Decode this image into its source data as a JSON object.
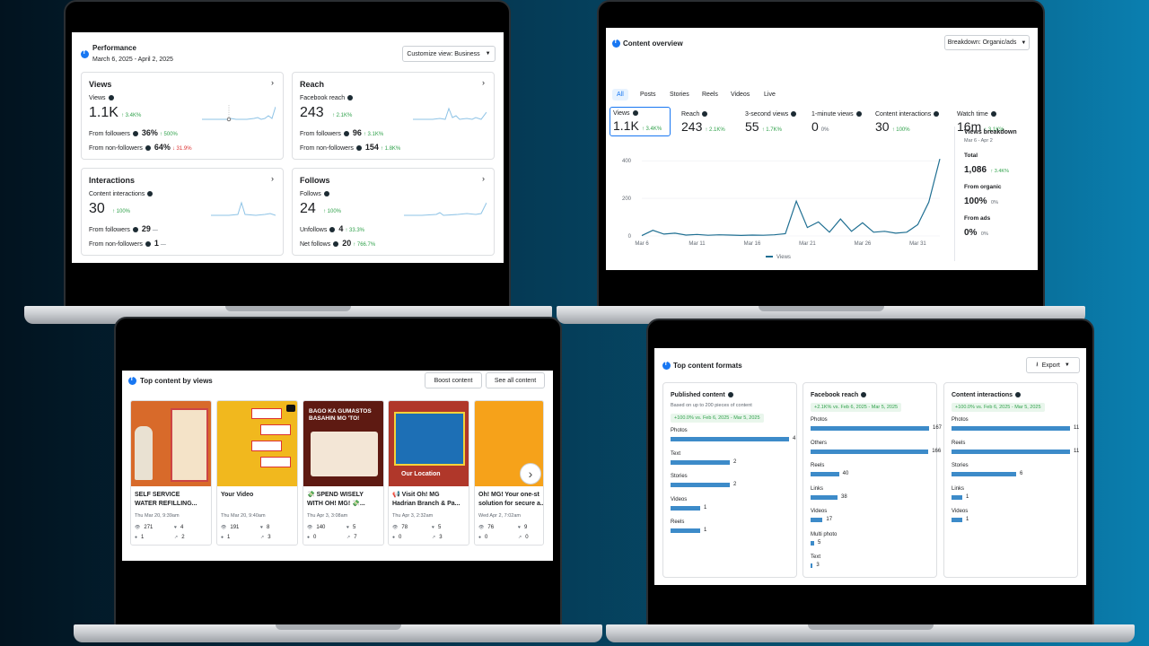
{
  "performance": {
    "title": "Performance",
    "date_range": "March 6, 2025 - April 2, 2025",
    "customize": "Customize view: Business",
    "views": {
      "title": "Views",
      "sub": "Views",
      "value": "1.1K",
      "delta": "↑ 3.4K%",
      "r1_label": "From followers",
      "r1_value": "36%",
      "r1_delta": "↑ 500%",
      "r2_label": "From non-followers",
      "r2_value": "64%",
      "r2_delta": "↓ 31.9%"
    },
    "reach": {
      "title": "Reach",
      "sub": "Facebook reach",
      "value": "243",
      "delta": "↑ 2.1K%",
      "r1_label": "From followers",
      "r1_value": "96",
      "r1_delta": "↑ 3.1K%",
      "r2_label": "From non-followers",
      "r2_value": "154",
      "r2_delta": "↑ 1.8K%"
    },
    "interactions": {
      "title": "Interactions",
      "sub": "Content interactions",
      "value": "30",
      "delta": "↑ 100%",
      "r1_label": "From followers",
      "r1_value": "29",
      "r1_delta": "—",
      "r2_label": "From non-followers",
      "r2_value": "1",
      "r2_delta": "—"
    },
    "follows": {
      "title": "Follows",
      "sub": "Follows",
      "value": "24",
      "delta": "↑ 100%",
      "r1_label": "Unfollows",
      "r1_value": "4",
      "r1_delta": "↑ 33.3%",
      "r2_label": "Net follows",
      "r2_value": "20",
      "r2_delta": "↑ 766.7%"
    }
  },
  "overview": {
    "title": "Content overview",
    "breakdown": "Breakdown: Organic/ads",
    "tabs": [
      "All",
      "Posts",
      "Stories",
      "Reels",
      "Videos",
      "Live"
    ],
    "metrics": [
      {
        "label": "Views",
        "value": "1.1K",
        "delta": "↑ 3.4K%"
      },
      {
        "label": "Reach",
        "value": "243",
        "delta": "↑ 2.1K%"
      },
      {
        "label": "3-second views",
        "value": "55",
        "delta": "↑ 1.7K%"
      },
      {
        "label": "1-minute views",
        "value": "0",
        "delta": "0%"
      },
      {
        "label": "Content interactions",
        "value": "30",
        "delta": "↑ 100%"
      },
      {
        "label": "Watch time",
        "value": "16m",
        "delta": "↑ 3.1K%"
      }
    ],
    "breakdown_panel": {
      "title": "Views breakdown",
      "range": "Mar 6 - Apr 2",
      "total_label": "Total",
      "total_value": "1,086",
      "total_delta": "↑ 3.4K%",
      "organic_label": "From organic",
      "organic_value": "100%",
      "organic_delta": "0%",
      "ads_label": "From ads",
      "ads_value": "0%",
      "ads_delta": "0%"
    }
  },
  "chart_data": {
    "type": "line",
    "x": [
      "Mar 6",
      "Mar 7",
      "Mar 8",
      "Mar 9",
      "Mar 10",
      "Mar 11",
      "Mar 12",
      "Mar 13",
      "Mar 14",
      "Mar 15",
      "Mar 16",
      "Mar 17",
      "Mar 18",
      "Mar 19",
      "Mar 20",
      "Mar 21",
      "Mar 22",
      "Mar 23",
      "Mar 24",
      "Mar 25",
      "Mar 26",
      "Mar 27",
      "Mar 28",
      "Mar 29",
      "Mar 30",
      "Mar 31",
      "Apr 1",
      "Apr 2"
    ],
    "series": [
      {
        "name": "Views",
        "values": [
          2,
          30,
          10,
          15,
          5,
          8,
          4,
          6,
          5,
          3,
          5,
          4,
          6,
          12,
          185,
          45,
          75,
          20,
          90,
          25,
          70,
          20,
          25,
          15,
          20,
          60,
          180,
          410
        ]
      }
    ],
    "xticks": [
      "Mar 6",
      "Mar 11",
      "Mar 16",
      "Mar 21",
      "Mar 26",
      "Mar 31"
    ],
    "yticks": [
      "0",
      "200",
      "400"
    ],
    "ylim": [
      0,
      420
    ],
    "legend": "bottom"
  },
  "top_content": {
    "title": "Top content by views",
    "boost": "Boost content",
    "see_all": "See all content",
    "posts": [
      {
        "title": "SELF SERVICE\nWATER REFILLING...",
        "date": "Thu Mar 20, 9:39am",
        "views": "271",
        "likes": "4",
        "comments": "1",
        "shares": "2",
        "color": "#d86a2a"
      },
      {
        "title": "Your Video",
        "date": "Thu Mar 20, 9:40am",
        "views": "191",
        "likes": "8",
        "comments": "1",
        "shares": "3",
        "color": "#f1b81e"
      },
      {
        "title": "💸 SPEND WISELY\nWITH OH! MG! 💸...",
        "date": "Thu Apr 3, 3:08am",
        "views": "140",
        "likes": "5",
        "comments": "0",
        "shares": "7",
        "color": "#5e1a12"
      },
      {
        "title": "📢 Visit Oh! MG\nHadrian Branch & Pa...",
        "date": "Thu Apr 3, 2:32am",
        "views": "78",
        "likes": "5",
        "comments": "0",
        "shares": "3",
        "color": "#b0372a"
      },
      {
        "title": "Oh! MG! Your one-st\nsolution for secure a...",
        "date": "Wed Apr 2, 7:02am",
        "views": "76",
        "likes": "9",
        "comments": "0",
        "shares": "0",
        "color": "#f6a21a"
      }
    ],
    "thumb_texts": [
      "BAGO KA GUMASTOS BASAHIN MO 'TO!",
      "Our Location"
    ]
  },
  "formats": {
    "title": "Top content formats",
    "export": "Export",
    "columns": [
      {
        "title": "Published content",
        "sub": "Based on up to 200 pieces of content",
        "badge": "+100.0% vs. Feb 6, 2025 - Mar 5, 2025",
        "max": 4,
        "rows": [
          {
            "label": "Photos",
            "value": 4
          },
          {
            "label": "Text",
            "value": 2
          },
          {
            "label": "Stories",
            "value": 2
          },
          {
            "label": "Videos",
            "value": 1
          },
          {
            "label": "Reels",
            "value": 1
          }
        ]
      },
      {
        "title": "Facebook reach",
        "sub": "",
        "badge": "+2.1K% vs. Feb 6, 2025 - Mar 5, 2025",
        "max": 167,
        "rows": [
          {
            "label": "Photos",
            "value": 167
          },
          {
            "label": "Others",
            "value": 166
          },
          {
            "label": "Reels",
            "value": 40
          },
          {
            "label": "Links",
            "value": 38
          },
          {
            "label": "Videos",
            "value": 17
          },
          {
            "label": "Multi photo",
            "value": 5
          },
          {
            "label": "Text",
            "value": 3
          }
        ]
      },
      {
        "title": "Content interactions",
        "sub": "",
        "badge": "+100.0% vs. Feb 6, 2025 - Mar 5, 2025",
        "max": 11,
        "rows": [
          {
            "label": "Photos",
            "value": 11
          },
          {
            "label": "Reels",
            "value": 11
          },
          {
            "label": "Stories",
            "value": 6
          },
          {
            "label": "Links",
            "value": 1
          },
          {
            "label": "Videos",
            "value": 1
          }
        ]
      }
    ]
  },
  "colors": {
    "accent": "#1877f2",
    "line": "#1f6f92",
    "bar": "#3d8bc9",
    "up": "#31a24c",
    "down": "#dd3333"
  }
}
